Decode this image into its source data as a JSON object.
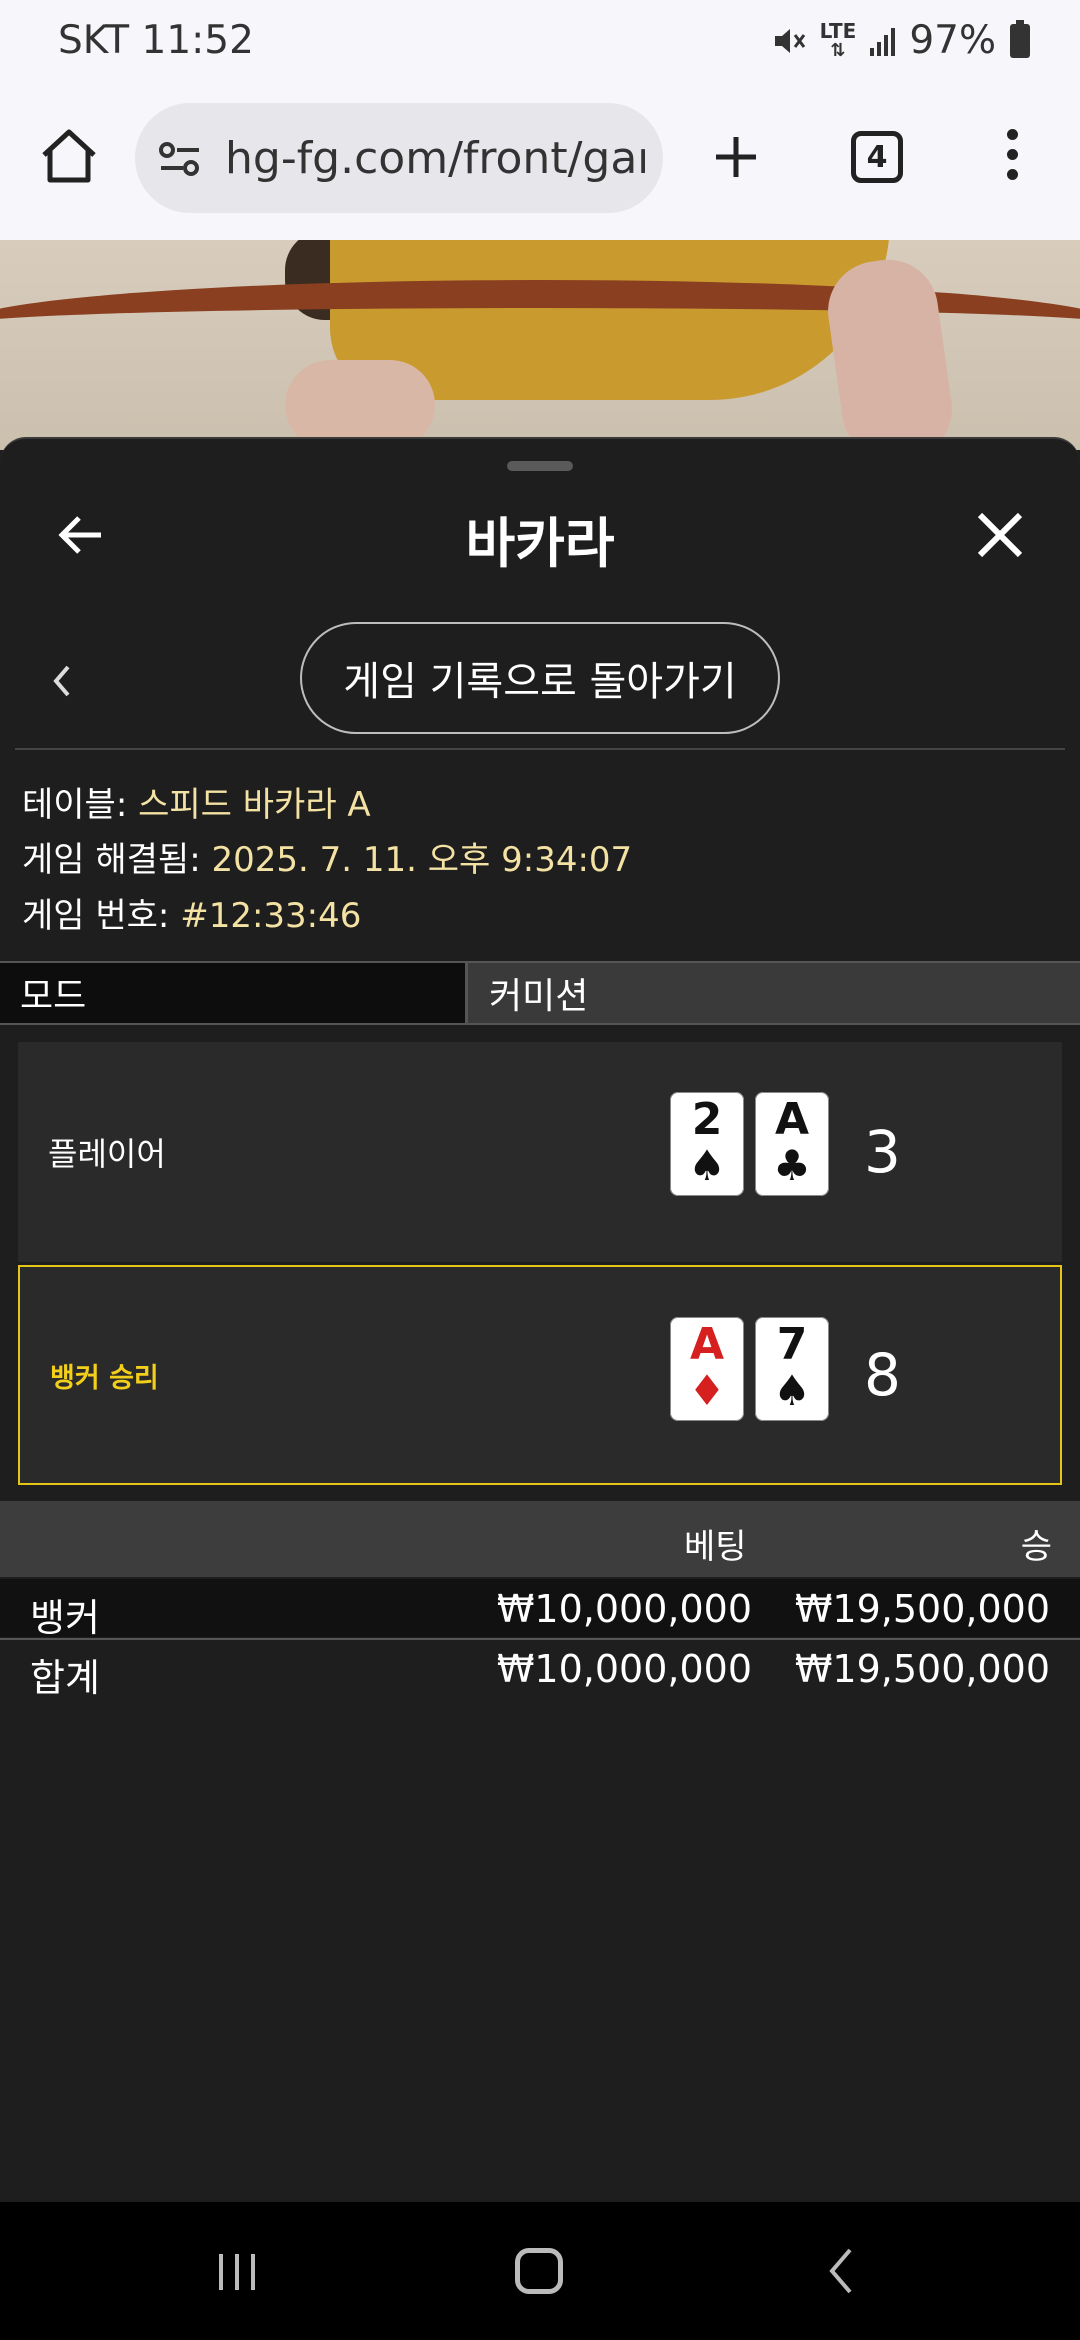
{
  "status": {
    "carrier_time": "SKT 11:52",
    "network": "LTE",
    "battery": "97%",
    "icons": [
      "mute-icon",
      "lte-icon",
      "signal-icon",
      "battery-icon"
    ]
  },
  "browser": {
    "url": "hg-fg.com/front/gam",
    "tab_count": "4",
    "icons": [
      "home-icon",
      "site-settings-icon",
      "plus-icon",
      "tabs-icon",
      "more-vert-icon"
    ]
  },
  "panel": {
    "title": "바카라",
    "return_label": "게임 기록으로 돌아가기",
    "info": [
      {
        "label": "테이블: ",
        "value": "스피드 바카라 A"
      },
      {
        "label": "게임 해결됨: ",
        "value": "2025. 7. 11. 오후 9:34:07"
      },
      {
        "label": "게임 번호: ",
        "value": "#12:33:46"
      }
    ],
    "mode_header": "모드",
    "commission_header": "커미션",
    "player": {
      "label": "플레이어",
      "cards": [
        {
          "rank": "2",
          "suit": "♠",
          "color": "black"
        },
        {
          "rank": "A",
          "suit": "♣",
          "color": "black"
        }
      ],
      "score": "3"
    },
    "banker": {
      "label": "뱅커 승리",
      "cards": [
        {
          "rank": "A",
          "suit": "♦",
          "color": "red"
        },
        {
          "rank": "7",
          "suit": "♠",
          "color": "black"
        }
      ],
      "score": "8"
    },
    "bet_table": {
      "headers": [
        "베팅",
        "승"
      ],
      "rows": [
        {
          "name": "뱅커",
          "bet": "₩10,000,000",
          "win": "₩19,500,000"
        },
        {
          "name": "합계",
          "bet": "₩10,000,000",
          "win": "₩19,500,000"
        }
      ]
    }
  },
  "colors": {
    "accent_gold": "#f2cf1b",
    "info_value": "#f3e2a3",
    "panel_bg": "#1e1e1e"
  }
}
